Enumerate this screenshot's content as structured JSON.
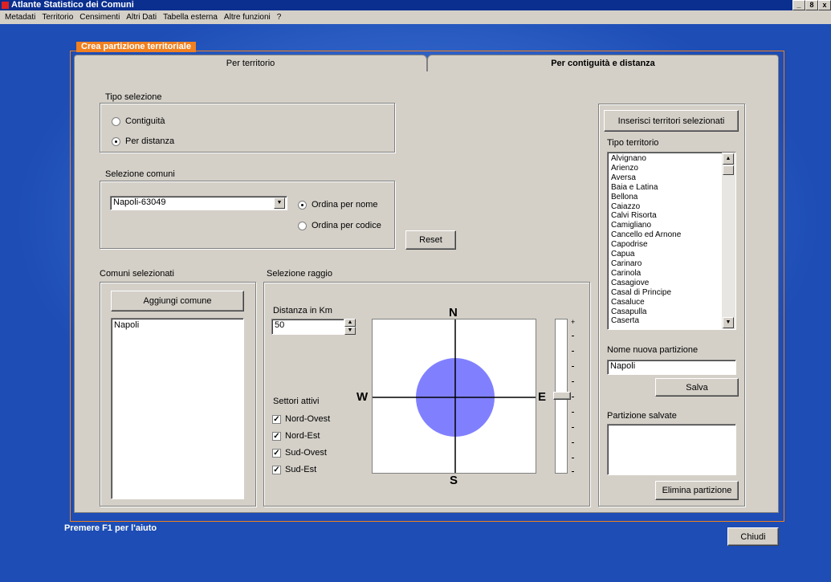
{
  "window": {
    "title": "Atlante Statistico dei Comuni",
    "controls": [
      "_",
      "8",
      "x"
    ]
  },
  "menu": [
    "Metadati",
    "Territorio",
    "Censimenti",
    "Altri Dati",
    "Tabella esterna",
    "Altre funzioni",
    "?"
  ],
  "dialog": {
    "title": "Crea partizione territoriale"
  },
  "tabs": [
    {
      "label": "Per territorio",
      "active": false
    },
    {
      "label": "Per contiguità e distanza",
      "active": true
    }
  ],
  "tipo_selezione": {
    "label": "Tipo selezione",
    "options": [
      {
        "label": "Contiguità",
        "checked": false
      },
      {
        "label": "Per distanza",
        "checked": true
      }
    ]
  },
  "selezione_comuni": {
    "label": "Selezione comuni",
    "combo_value": "Napoli-63049",
    "order_options": [
      {
        "label": "Ordina per nome",
        "checked": true
      },
      {
        "label": "Ordina per codice",
        "checked": false
      }
    ]
  },
  "reset_label": "Reset",
  "comuni_selezionati": {
    "label": "Comuni selezionati",
    "add_button": "Aggiungi comune",
    "items": [
      "Napoli"
    ]
  },
  "selezione_raggio": {
    "label": "Selezione raggio",
    "distanza_label": "Distanza in Km",
    "distanza_value": "50",
    "settori_label": "Settori attivi",
    "settori": [
      {
        "label": "Nord-Ovest",
        "checked": true
      },
      {
        "label": "Nord-Est",
        "checked": true
      },
      {
        "label": "Sud-Ovest",
        "checked": true
      },
      {
        "label": "Sud-Est",
        "checked": true
      }
    ],
    "compass": {
      "north": "N",
      "south": "S",
      "west": "W",
      "east": "E",
      "circle_color": "#8080ff"
    },
    "slider_top_mark": "+",
    "slider_level": 0.5
  },
  "right_panel": {
    "insert_button": "Inserisci territori selezionati",
    "tipo_territorio_label": "Tipo territorio",
    "territori": [
      "Alvignano",
      "Arienzo",
      "Aversa",
      "Baia e Latina",
      "Bellona",
      "Caiazzo",
      "Calvi Risorta",
      "Camigliano",
      "Cancello ed Arnone",
      "Capodrise",
      "Capua",
      "Carinaro",
      "Carinola",
      "Casagiove",
      "Casal di Principe",
      "Casaluce",
      "Casapulla",
      "Caserta"
    ],
    "nome_label": "Nome nuova partizione",
    "nome_value": "Napoli",
    "salva_label": "Salva",
    "salvate_label": "Partizione salvate",
    "elimina_label": "Elimina partizione"
  },
  "footer": {
    "help": "Premere F1 per l'aiuto",
    "chiudi": "Chiudi"
  }
}
